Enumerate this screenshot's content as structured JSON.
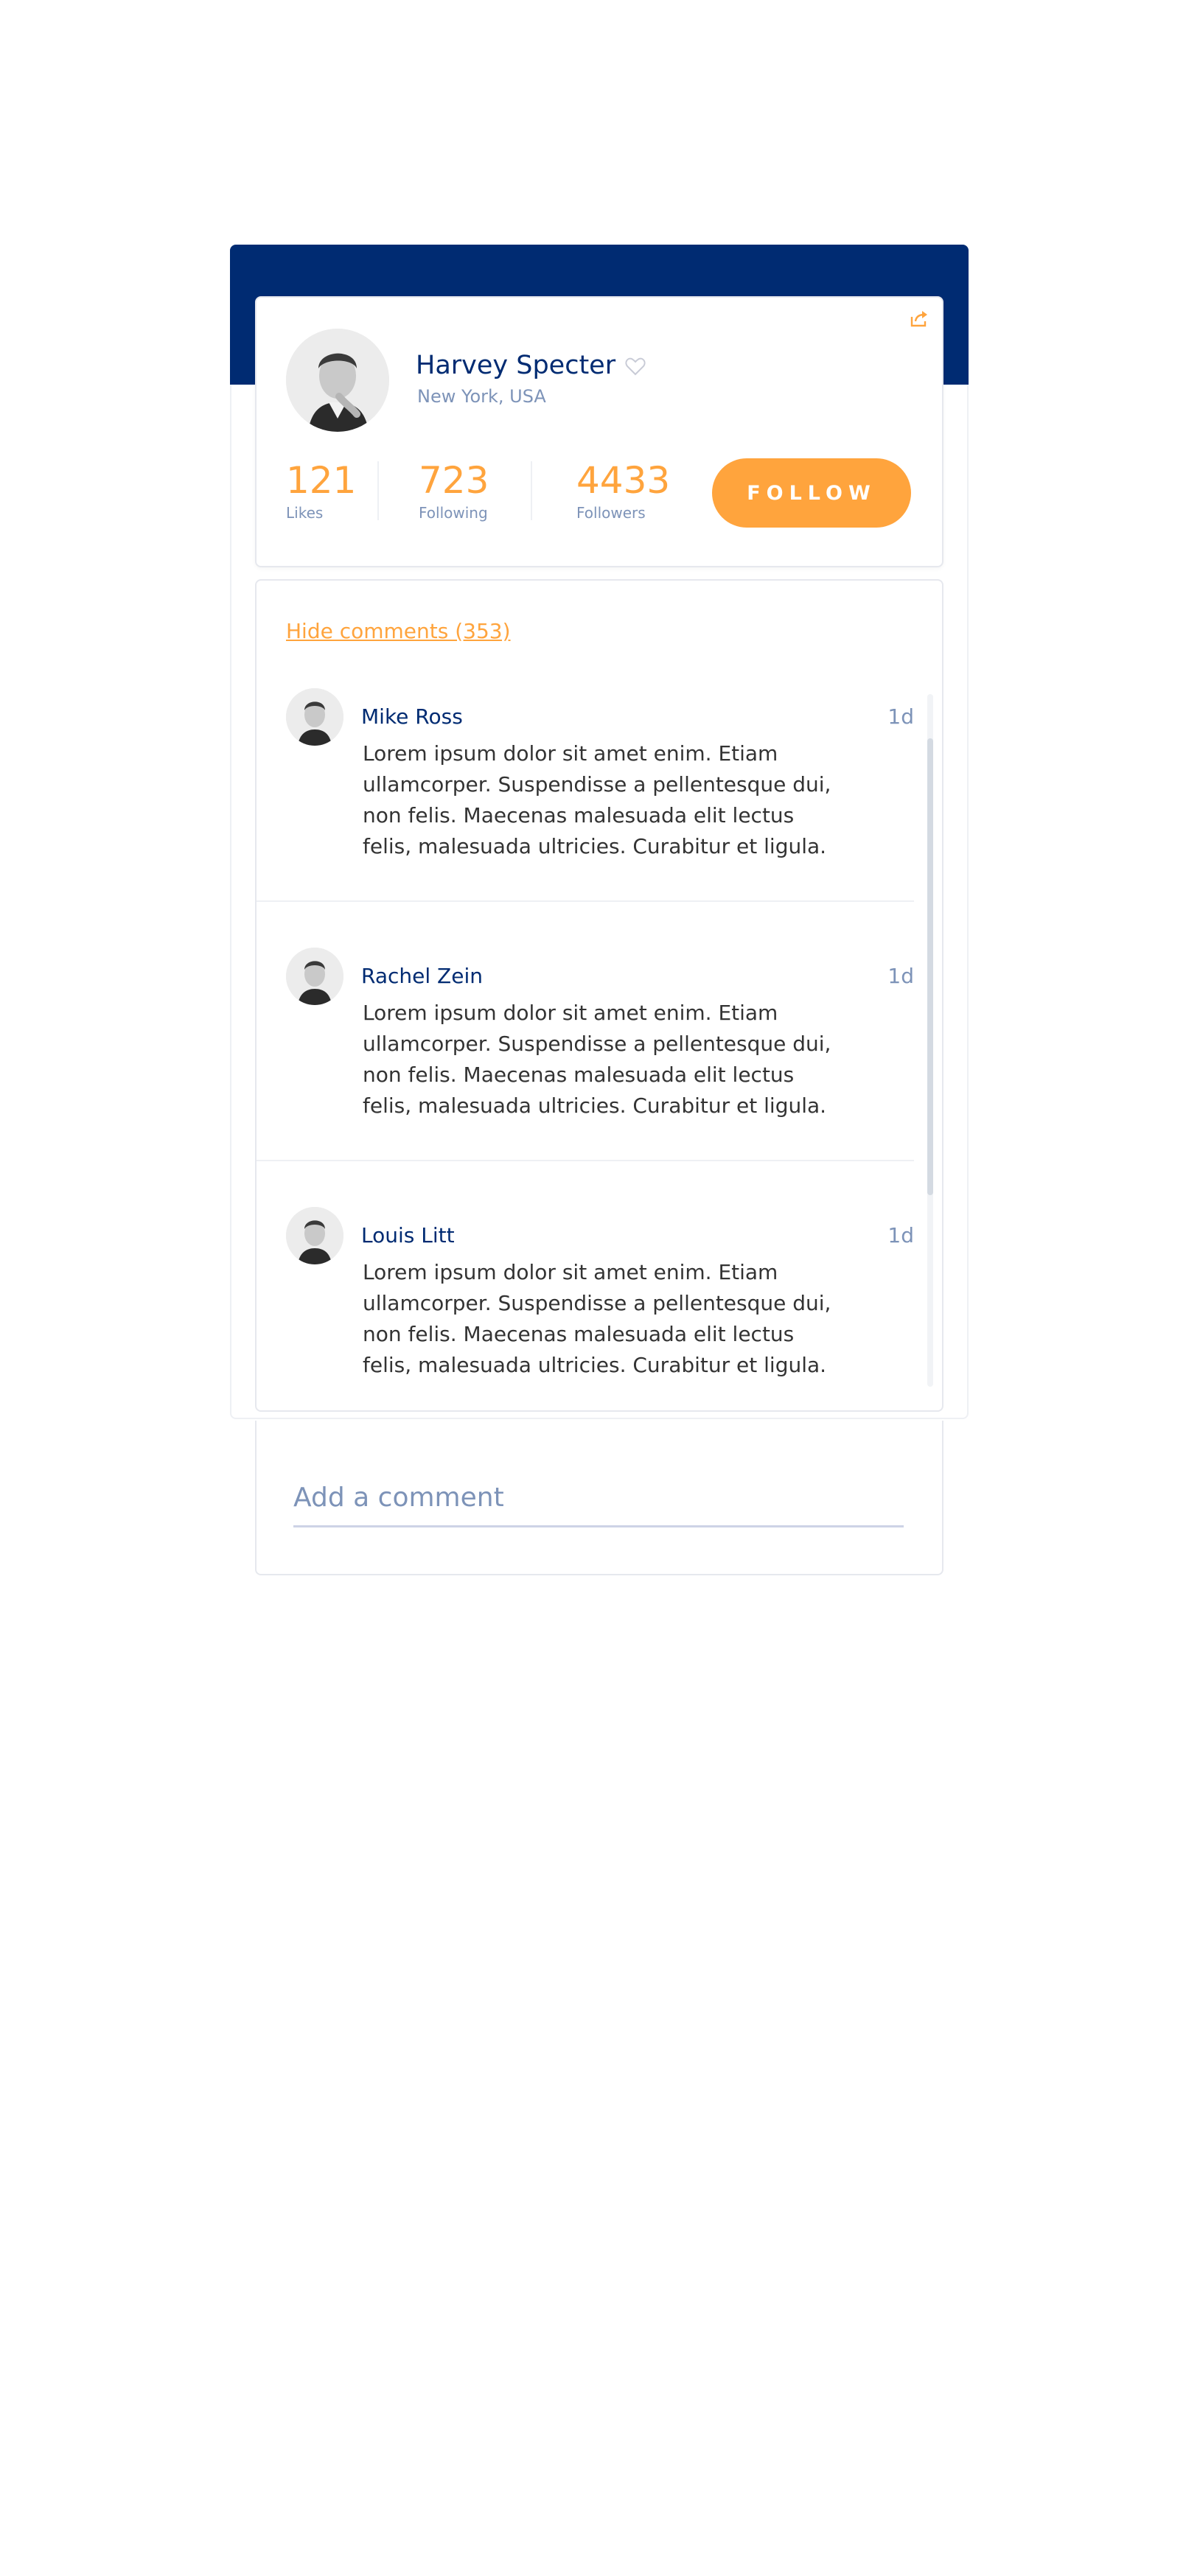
{
  "profile": {
    "name": "Harvey Specter",
    "location": "New York, USA",
    "stats": [
      {
        "value": "121",
        "label": "Likes"
      },
      {
        "value": "723",
        "label": "Following"
      },
      {
        "value": "4433",
        "label": "Followers"
      }
    ],
    "follow_label": "FOLLOW"
  },
  "comments": {
    "toggle_label": "Hide comments (353)",
    "items": [
      {
        "author": "Mike Ross",
        "time": "1d",
        "text": "Lorem ipsum dolor sit amet enim. Etiam ullamcorper. Suspendisse a pellentesque dui, non felis. Maecenas malesuada elit lectus felis, malesuada ultricies. Curabitur et ligula."
      },
      {
        "author": "Rachel Zein",
        "time": "1d",
        "text": "Lorem ipsum dolor sit amet enim. Etiam ullamcorper. Suspendisse a pellentesque dui, non felis. Maecenas malesuada elit lectus felis, malesuada ultricies. Curabitur et ligula."
      },
      {
        "author": "Louis Litt",
        "time": "1d",
        "text": "Lorem ipsum dolor sit amet enim. Etiam ullamcorper. Suspendisse a pellentesque dui, non felis. Maecenas malesuada elit lectus felis, malesuada ultricies. Curabitur et ligula."
      }
    ],
    "add_placeholder": "Add a comment"
  },
  "colors": {
    "primary": "#002b72",
    "accent": "#ffa43d",
    "muted": "#7d93b8"
  },
  "icons": [
    "share-icon",
    "heart-icon",
    "avatar"
  ]
}
